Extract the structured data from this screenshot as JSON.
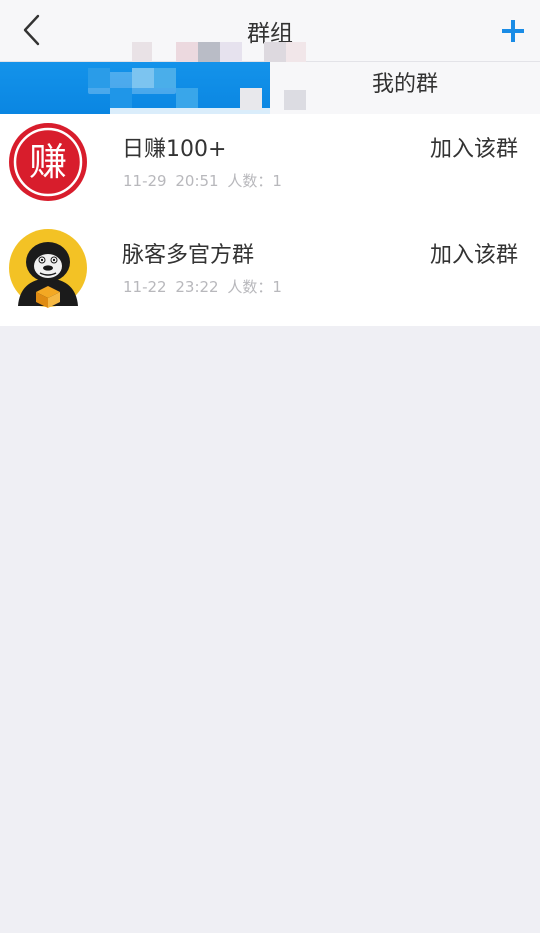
{
  "header": {
    "title": "群组",
    "back_icon": "chevron-left-icon",
    "add_icon": "plus-icon"
  },
  "tabs": {
    "mine_label": "我的群",
    "active_color": "#0a86e2"
  },
  "groups": [
    {
      "avatar_text": "赚",
      "name": "日赚100+",
      "date": "11-29 20:51",
      "members": "人数：1",
      "action": "加入该群"
    },
    {
      "avatar_icon": "gorilla-mascot-icon",
      "name": "脉客多官方群",
      "date": "11-22 23:22",
      "members": "人数：1",
      "action": "加入该群"
    }
  ],
  "colors": {
    "accent": "#1a8ce6",
    "avatar_red": "#d81d2c",
    "avatar_yellow": "#f3c225",
    "meta_text": "#b8b8bc",
    "page_bg": "#efeff4"
  }
}
